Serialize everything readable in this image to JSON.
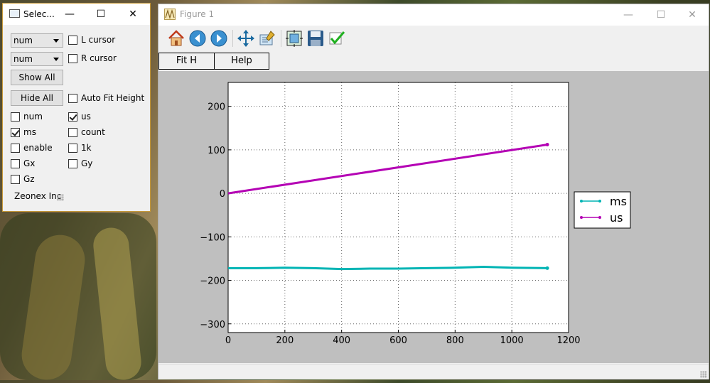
{
  "selector": {
    "title": "Selec...",
    "combo1": "num",
    "combo2": "num",
    "l_cursor": "L cursor",
    "r_cursor": "R cursor",
    "show_all": "Show All",
    "hide_all": "Hide All",
    "auto_fit": "Auto Fit Height",
    "channels": [
      {
        "label": "num",
        "checked": false
      },
      {
        "label": "us",
        "checked": true
      },
      {
        "label": "ms",
        "checked": true
      },
      {
        "label": "count",
        "checked": false
      },
      {
        "label": "enable",
        "checked": false
      },
      {
        "label": "1k",
        "checked": false
      },
      {
        "label": "Gx",
        "checked": false
      },
      {
        "label": "Gy",
        "checked": false
      },
      {
        "label": "Gz",
        "checked": false
      }
    ],
    "footer": "Zeonex Inc"
  },
  "figure": {
    "title": "Figure 1",
    "fit_h": "Fit H",
    "help": "Help",
    "toolbar_icons": [
      "home-icon",
      "back-icon",
      "forward-icon",
      "pan-icon",
      "configure-icon",
      "subplots-icon",
      "save-icon",
      "check-icon"
    ]
  },
  "colors": {
    "ms": "#00b4b4",
    "us": "#b400b4",
    "plot_bg": "#bfbfbf"
  },
  "chart_data": {
    "type": "line",
    "title": "",
    "xlabel": "",
    "ylabel": "",
    "xlim": [
      0,
      1200
    ],
    "ylim": [
      -320,
      255
    ],
    "xticks": [
      0,
      200,
      400,
      600,
      800,
      1000,
      1200
    ],
    "yticks": [
      200,
      100,
      0,
      -100,
      -200,
      -300
    ],
    "grid": true,
    "legend": "right-outside",
    "series": [
      {
        "name": "ms",
        "color": "#00b4b4",
        "x": [
          0,
          100,
          200,
          300,
          400,
          500,
          600,
          700,
          800,
          900,
          1000,
          1125
        ],
        "y": [
          -172,
          -172,
          -171,
          -172,
          -174,
          -173,
          -173,
          -172,
          -171,
          -169,
          -171,
          -172
        ]
      },
      {
        "name": "us",
        "color": "#b400b4",
        "x": [
          0,
          1125
        ],
        "y": [
          0,
          112
        ]
      }
    ]
  }
}
